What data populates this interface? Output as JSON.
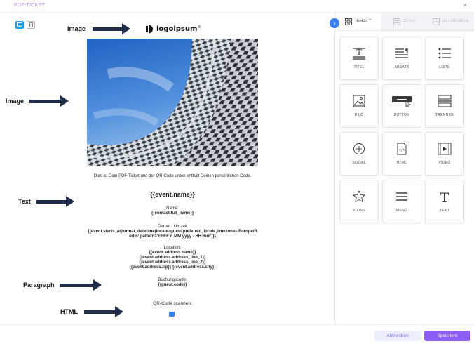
{
  "window": {
    "title": "PDF-TICKET",
    "close_glyph": "×"
  },
  "ticket": {
    "logo_text": "logoipsum",
    "logo_mark": "®",
    "intro": "Dies ist Dein PDF-Ticket und der QR-Code unten enthält Deinen persönlichen Code.",
    "event_name": "{{event.name}}",
    "name_label": "Name:",
    "name_code": "{{contact.full_name}}",
    "date_label": "Datum / Uhrzeit",
    "date_code": "{{event.starts_at|format_datetime(locale=guest.preferred_locale,timezone='Europe/Berlin',pattern='EEEE d.MM.yyyy - HH:mm')}}",
    "location_label": "Location:",
    "location_lines": [
      "{{event.address.name}}",
      "{{event.address.address_line_1}}",
      "{{event.address.address_line_2}}",
      "{{event.address.zip}} {{event.address.city}}"
    ],
    "booking_label": "Buchungscode:",
    "booking_code": "{{guest.code}}",
    "qr_label": "QR-Code scannen:"
  },
  "annotations": [
    "Image",
    "Image",
    "Text",
    "Paragraph",
    "HTML"
  ],
  "panel": {
    "tabs": [
      {
        "label": "INHALT",
        "icon": "grid-icon"
      },
      {
        "label": "ZEILE",
        "icon": "rows-icon"
      },
      {
        "label": "ALLGEMEIN",
        "icon": "settings-panel-icon"
      }
    ],
    "tiles": [
      {
        "label": "TITEL",
        "icon": "heading-icon"
      },
      {
        "label": "ABSATZ",
        "icon": "paragraph-icon"
      },
      {
        "label": "LISTE",
        "icon": "list-icon"
      },
      {
        "label": "BILD",
        "icon": "image-icon"
      },
      {
        "label": "BUTTON",
        "icon": "button-icon"
      },
      {
        "label": "TRENNER",
        "icon": "divider-icon"
      },
      {
        "label": "SOZIAL",
        "icon": "social-icon"
      },
      {
        "label": "HTML",
        "icon": "html-icon"
      },
      {
        "label": "VIDEO",
        "icon": "video-icon"
      },
      {
        "label": "ICONS",
        "icon": "star-icon"
      },
      {
        "label": "MENÜ",
        "icon": "menu-icon"
      },
      {
        "label": "TEXT",
        "icon": "text-icon"
      }
    ]
  },
  "footer": {
    "cancel_label": "Abbrechen",
    "save_label": "Speichern"
  },
  "colors": {
    "accent": "#8b5cf6",
    "device_active": "#1e9bf0",
    "arrow": "#1f2d4b",
    "title": "#a78bfa"
  }
}
